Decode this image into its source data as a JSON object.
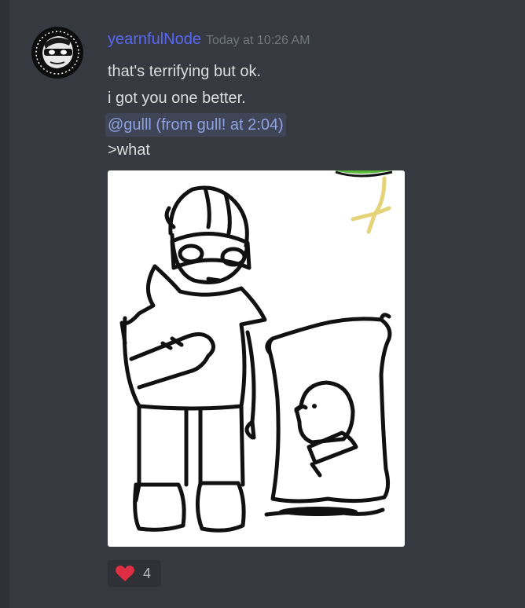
{
  "message": {
    "author": "yearnfulNode",
    "timestamp": "Today at 10:26 AM",
    "lines": [
      "that's terrifying but ok.",
      "i got you one better."
    ],
    "mention": "@gulll (from gull! at 2:04)",
    "quote": ">what",
    "reaction": {
      "emoji": "heart-icon",
      "count": "4"
    }
  },
  "colors": {
    "background": "#36393f",
    "username": "#5968f2",
    "timestamp": "#72767d",
    "text": "#dcddde",
    "mention_text": "#8ea1e1",
    "reaction_bg": "#2f3136",
    "heart": "#dd2e44"
  }
}
